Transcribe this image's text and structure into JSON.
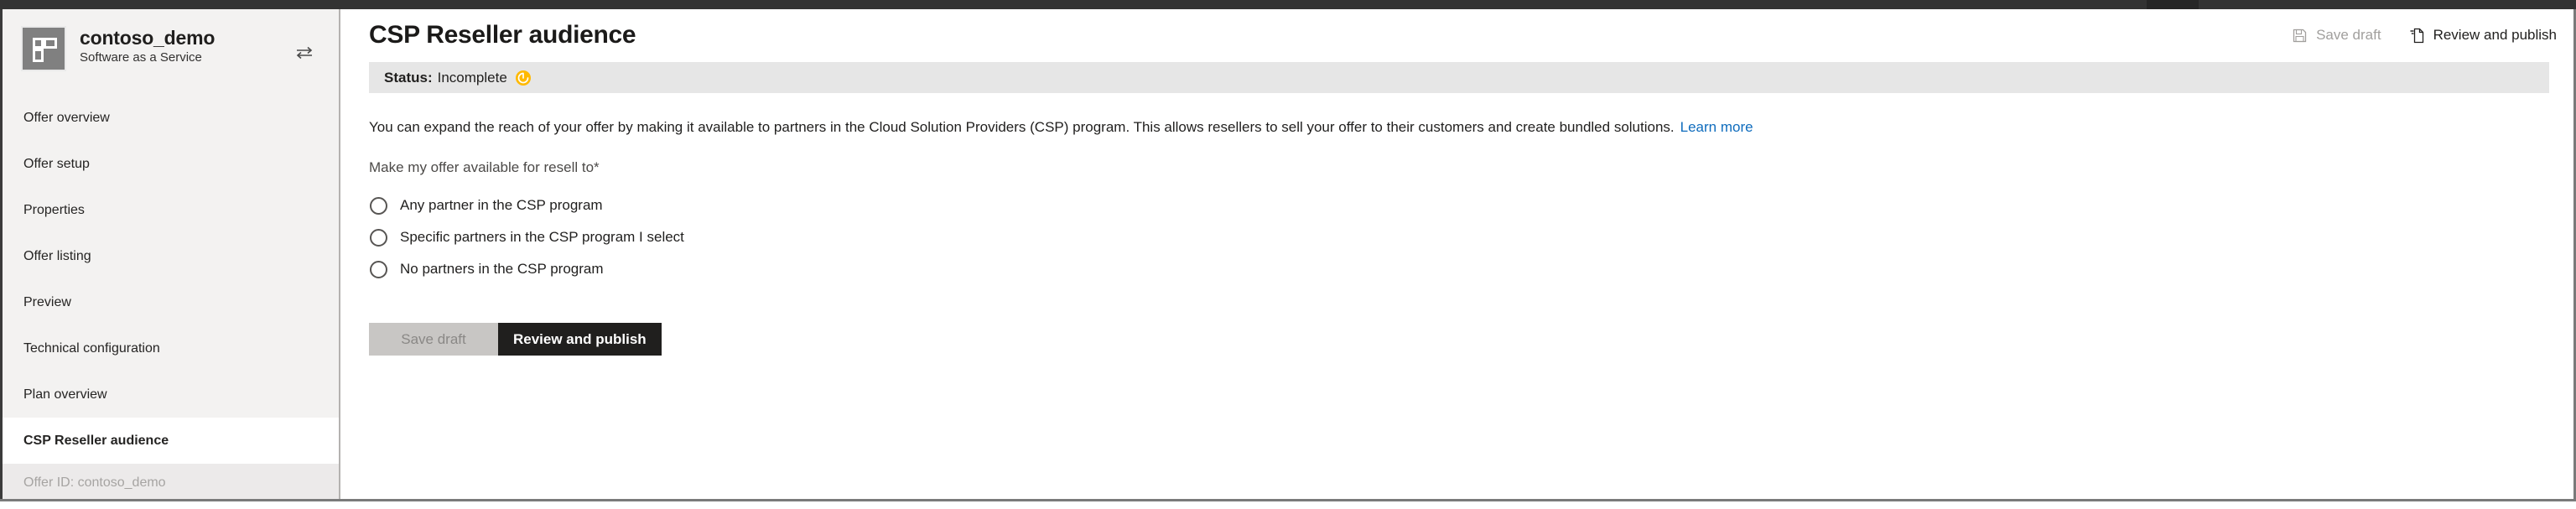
{
  "window": {
    "topbar_color": "#333333"
  },
  "sidebar": {
    "offer_name": "contoso_demo",
    "offer_type": "Software as a Service",
    "switch_icon": "switch-offer-icon",
    "logo_icon": "offer-tile-icon",
    "items": [
      {
        "label": "Offer overview",
        "selected": false
      },
      {
        "label": "Offer setup",
        "selected": false
      },
      {
        "label": "Properties",
        "selected": false
      },
      {
        "label": "Offer listing",
        "selected": false
      },
      {
        "label": "Preview",
        "selected": false
      },
      {
        "label": "Technical configuration",
        "selected": false
      },
      {
        "label": "Plan overview",
        "selected": false
      },
      {
        "label": "CSP Reseller audience",
        "selected": true
      }
    ],
    "footer": "Offer ID: contoso_demo"
  },
  "header": {
    "title": "CSP Reseller audience",
    "commands": [
      {
        "label": "Save draft",
        "icon": "save-icon",
        "enabled": false
      },
      {
        "label": "Review and publish",
        "icon": "publish-page-icon",
        "enabled": true
      }
    ]
  },
  "status": {
    "label": "Status:",
    "value": "Incomplete",
    "icon": "clock-pending-icon",
    "icon_color": "#ffb900",
    "band_color": "#e6e6e6"
  },
  "main": {
    "intro_text": "You can expand the reach of your offer by making it available to partners in the Cloud Solution Providers (CSP) program. This allows resellers to sell your offer to their customers and create bundled solutions.",
    "intro_link": "Learn more",
    "field_label": "Make my offer available for resell to",
    "required_marker": "*",
    "radio_options": [
      {
        "label": "Any partner in the CSP program",
        "selected": false
      },
      {
        "label": "Specific partners in the CSP program I select",
        "selected": false
      },
      {
        "label": "No partners in the CSP program",
        "selected": false
      }
    ],
    "buttons": {
      "save_draft": "Save draft",
      "review_publish": "Review and publish"
    }
  },
  "colors": {
    "link": "#0f6cbd",
    "primary_button": "#201f1e",
    "sidebar_bg": "#f3f2f1"
  }
}
